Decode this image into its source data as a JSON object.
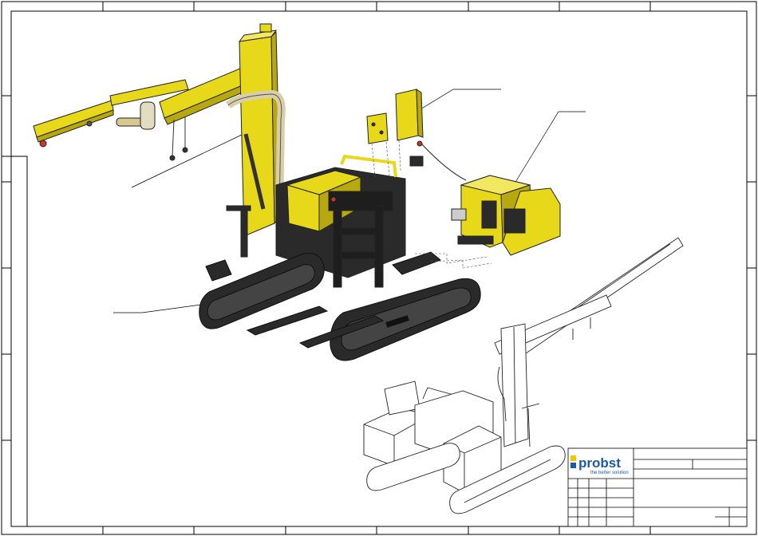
{
  "title_block": {
    "brand_name": "probst",
    "brand_tagline": "the better solution"
  },
  "colors": {
    "machine_yellow": "#e8d81a",
    "machine_yellow_shade": "#b8a810",
    "track_black": "#2a2a2a",
    "frame_line": "#000000",
    "brand_blue": "#1d5aa8",
    "brand_yellow": "#f0c800"
  }
}
